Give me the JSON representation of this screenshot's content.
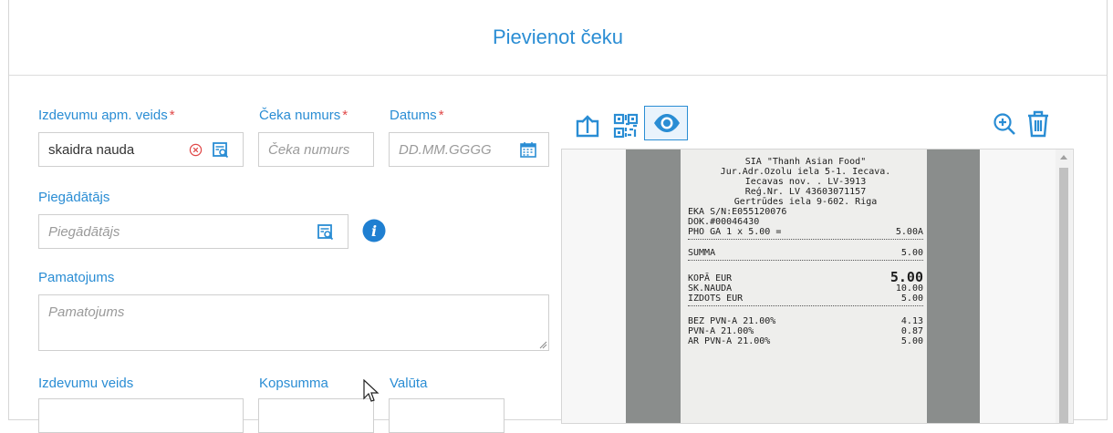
{
  "dialog": {
    "title": "Pievienot čeku"
  },
  "form": {
    "payment_type": {
      "label": "Izdevumu apm. veids",
      "required_mark": "*",
      "value": "skaidra nauda"
    },
    "receipt_number": {
      "label": "Čeka numurs",
      "required_mark": "*",
      "placeholder": "Čeka numurs"
    },
    "date": {
      "label": "Datums",
      "required_mark": "*",
      "placeholder": "DD.MM.GGGG"
    },
    "supplier": {
      "label": "Piegādātājs",
      "placeholder": "Piegādātājs"
    },
    "justification": {
      "label": "Pamatojums",
      "placeholder": "Pamatojums"
    },
    "expense_type": {
      "label": "Izdevumu veids"
    },
    "total": {
      "label": "Kopsumma"
    },
    "currency": {
      "label": "Valūta"
    }
  },
  "toolbar": {
    "upload_icon": "upload-icon",
    "qr_icon": "qr-code-icon",
    "view_icon": "eye-icon",
    "zoom_icon": "zoom-in-icon",
    "delete_icon": "trash-icon"
  },
  "receipt": {
    "header": [
      "SIA \"Thanh Asian Food\"",
      "Jur.Adr.Ozolu iela 5-1. Iecava.",
      "Iecavas nov. . LV-3913",
      "Reģ.Nr. LV 43603071157",
      "Gertrūdes iela 9-602. Riga"
    ],
    "info": [
      "EKA S/N:E055120076",
      "DOK.#00046430"
    ],
    "item": {
      "name": "PHO GA  1 x 5.00 =",
      "amount": "5.00A"
    },
    "summa": {
      "name": "SUMMA",
      "amount": "5.00"
    },
    "kopa": {
      "name": "KOPĀ EUR",
      "amount": "5.00"
    },
    "cash": {
      "name": "SK.NAUDA",
      "amount": "10.00"
    },
    "change": {
      "name": "IZDOTS EUR",
      "amount": "5.00"
    },
    "vat1": {
      "name": "BEZ PVN-A 21.00%",
      "amount": "4.13"
    },
    "vat2": {
      "name": "PVN-A 21.00%",
      "amount": "0.87"
    },
    "vat3": {
      "name": "AR PVN-A 21.00%",
      "amount": "5.00"
    }
  },
  "colors": {
    "accent": "#2a8dd4",
    "required": "#e04848"
  }
}
